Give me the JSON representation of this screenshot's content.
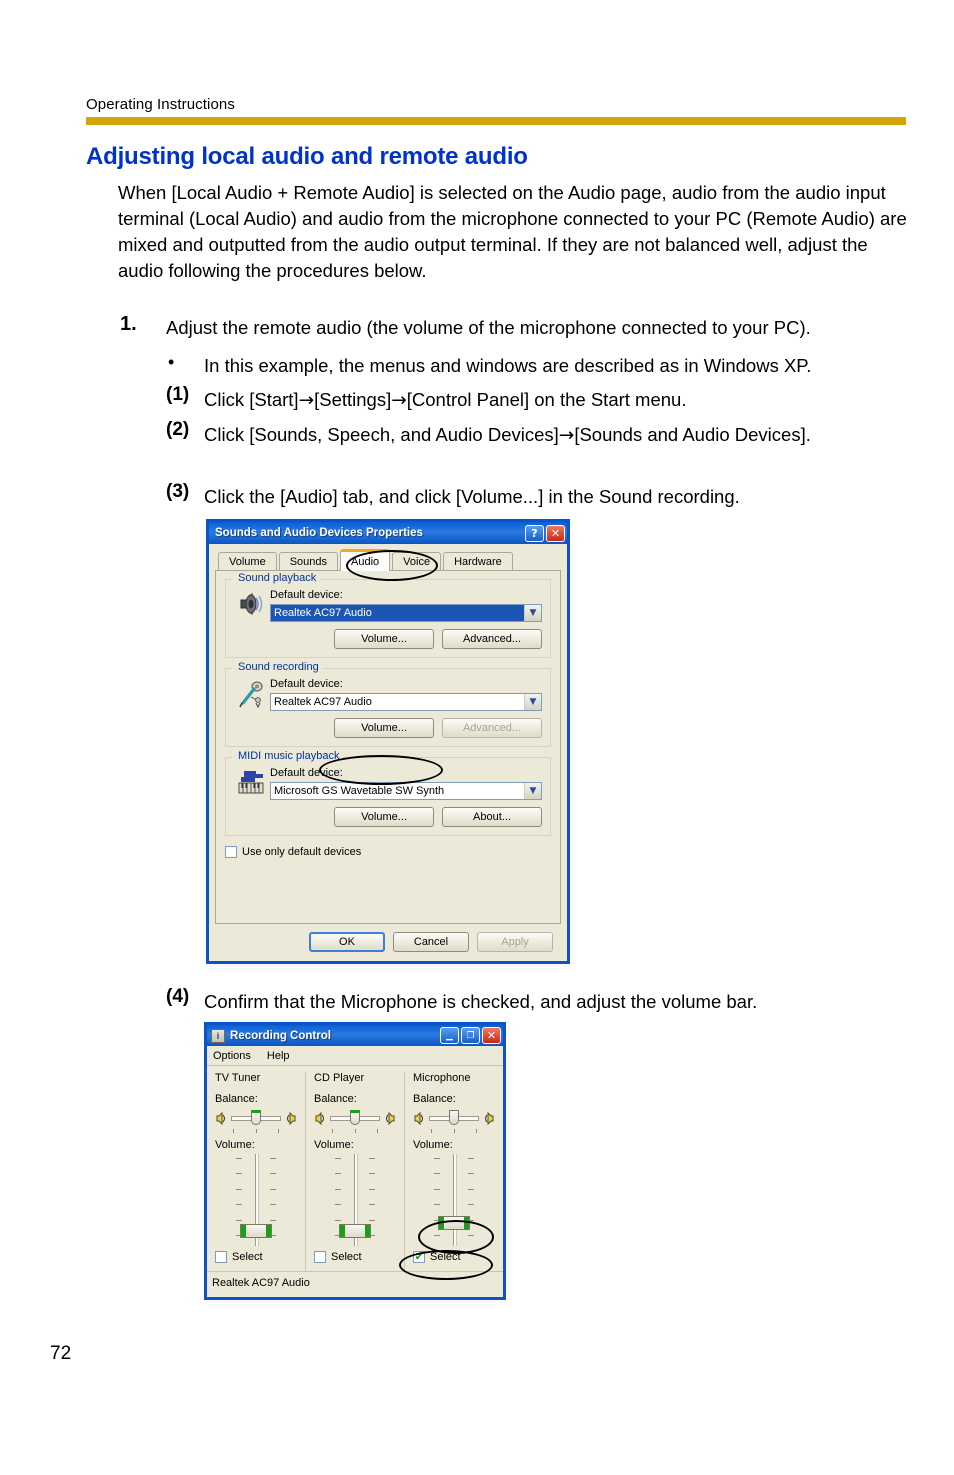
{
  "page": {
    "running_head": "Operating Instructions",
    "page_number": "72",
    "rule_color": "#d4a509",
    "heading_color": "#0033cc"
  },
  "section": {
    "title": "Adjusting local audio and remote audio",
    "intro": "When [Local Audio + Remote Audio] is selected on the Audio page, audio from the audio input terminal (Local Audio) and audio from the microphone connected to your PC (Remote Audio) are mixed and outputted from the audio output terminal. If they are not balanced well, adjust the audio following the procedures below."
  },
  "steps": {
    "step1_number": "1.",
    "step1_text": "Adjust the remote audio (the volume of the microphone connected to your PC).",
    "bullet_marker": "•",
    "bullet_text": "In this example, the menus and windows are described as in Windows XP.",
    "sub1_number": "(1)",
    "sub1_text_a": "Click [Start]",
    "sub1_arrow1": "→",
    "sub1_text_b": "[Settings]",
    "sub1_arrow2": "→",
    "sub1_text_c": "[Control Panel] on the Start menu.",
    "sub2_number": "(2)",
    "sub2_text_a": "Click [Sounds, Speech, and Audio Devices]",
    "sub2_arrow1": "→",
    "sub2_text_b": "[Sounds and Audio Devices].",
    "sub3_number": "(3)",
    "sub3_text": "Click the [Audio] tab, and click [Volume...] in the Sound recording.",
    "sub4_number": "(4)",
    "sub4_text": "Confirm that the Microphone is checked, and adjust the volume bar."
  },
  "sounds_dialog": {
    "title": "Sounds and Audio Devices Properties",
    "help_button": "?",
    "close_button": "✕",
    "tabs": [
      {
        "label": "Volume",
        "active": false
      },
      {
        "label": "Sounds",
        "active": false
      },
      {
        "label": "Audio",
        "active": true
      },
      {
        "label": "Voice",
        "active": false
      },
      {
        "label": "Hardware",
        "active": false
      }
    ],
    "sound_playback": {
      "legend": "Sound playback",
      "device_label": "Default device:",
      "device_value": "Realtek AC97 Audio",
      "volume_button": "Volume...",
      "advanced_button": "Advanced..."
    },
    "sound_recording": {
      "legend": "Sound recording",
      "device_label": "Default device:",
      "device_value": "Realtek AC97 Audio",
      "volume_button": "Volume...",
      "advanced_button": "Advanced..."
    },
    "midi_playback": {
      "legend": "MIDI music playback",
      "device_label": "Default device:",
      "device_value": "Microsoft GS Wavetable SW Synth",
      "volume_button": "Volume...",
      "about_button": "About..."
    },
    "use_only_default_label": "Use only default devices",
    "footer": {
      "ok": "OK",
      "cancel": "Cancel",
      "apply": "Apply"
    }
  },
  "recording_control": {
    "title": "Recording Control",
    "minimize_button": "_",
    "maximize_button": "□",
    "close_button": "✕",
    "menus": [
      "Options",
      "Help"
    ],
    "channels": [
      {
        "name": "TV Tuner",
        "balance_label": "Balance:",
        "volume_label": "Volume:",
        "select_label": "Select",
        "selected": false,
        "balance_percent": 50,
        "volume_percent": 20
      },
      {
        "name": "CD Player",
        "balance_label": "Balance:",
        "volume_label": "Volume:",
        "select_label": "Select",
        "selected": false,
        "balance_percent": 50,
        "volume_percent": 20
      },
      {
        "name": "Microphone",
        "balance_label": "Balance:",
        "volume_label": "Volume:",
        "select_label": "Select",
        "selected": true,
        "balance_percent": 50,
        "volume_percent": 26
      }
    ],
    "status_text": "Realtek AC97 Audio",
    "check_glyph": "✔"
  }
}
